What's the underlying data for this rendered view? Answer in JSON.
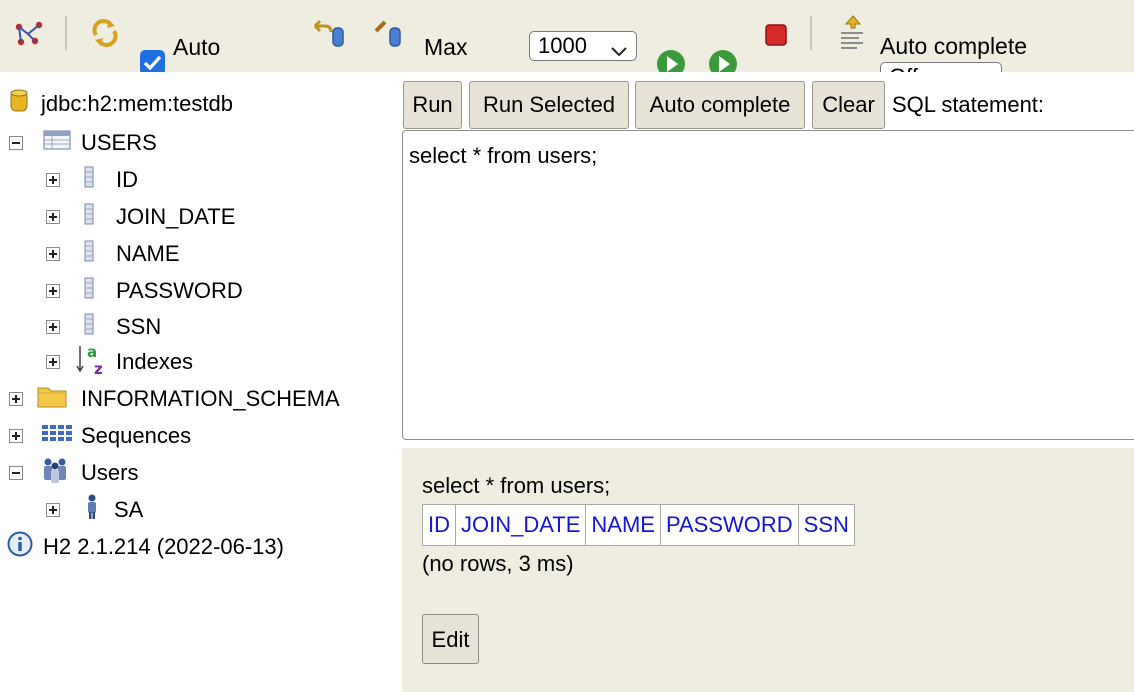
{
  "toolbar": {
    "auto_commit_label": "Auto",
    "auto_commit_checked": true,
    "max_label": "Max",
    "max_rows_value": "1000",
    "auto_complete_label": "Auto complete",
    "auto_complete_value": "Off",
    "icons": [
      "disconnect-icon",
      "refresh-icon",
      "rollback-icon",
      "commit-icon",
      "run-icon",
      "run-selected-icon",
      "stop-icon",
      "auto-complete-icon"
    ]
  },
  "tree": {
    "connection": "jdbc:h2:mem:testdb",
    "table": "USERS",
    "columns": [
      "ID",
      "JOIN_DATE",
      "NAME",
      "PASSWORD",
      "SSN"
    ],
    "indexes": "Indexes",
    "information_schema": "INFORMATION_SCHEMA",
    "sequences": "Sequences",
    "users": "Users",
    "user": "SA",
    "version": "H2 2.1.214 (2022-06-13)"
  },
  "editor": {
    "buttons": {
      "run": "Run",
      "run_selected": "Run Selected",
      "auto_complete": "Auto complete",
      "clear": "Clear"
    },
    "label": "SQL statement:",
    "query": "select * from users;"
  },
  "result": {
    "statement": "select * from users;",
    "headers": [
      "ID",
      "JOIN_DATE",
      "NAME",
      "PASSWORD",
      "SSN"
    ],
    "info": "(no rows, 3 ms)",
    "edit_label": "Edit"
  }
}
